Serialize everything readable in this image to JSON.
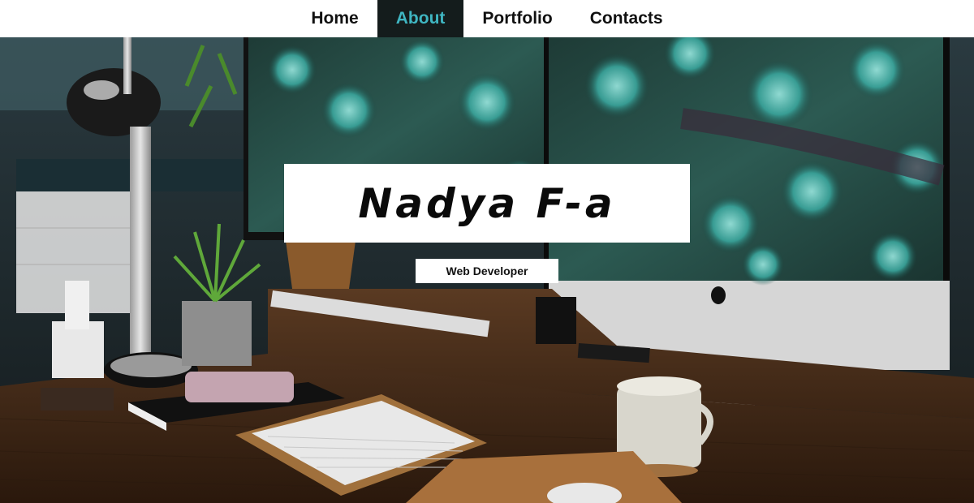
{
  "nav": {
    "items": [
      {
        "label": "Home",
        "active": false
      },
      {
        "label": "About",
        "active": true
      },
      {
        "label": "Portfolio",
        "active": false
      },
      {
        "label": "Contacts",
        "active": false
      }
    ],
    "active_bg": "#141c1c",
    "active_color": "#3fb6c2"
  },
  "hero": {
    "title": "Nadya F-a",
    "subtitle": "Web Developer",
    "background_image": "desk-workspace-photo"
  }
}
